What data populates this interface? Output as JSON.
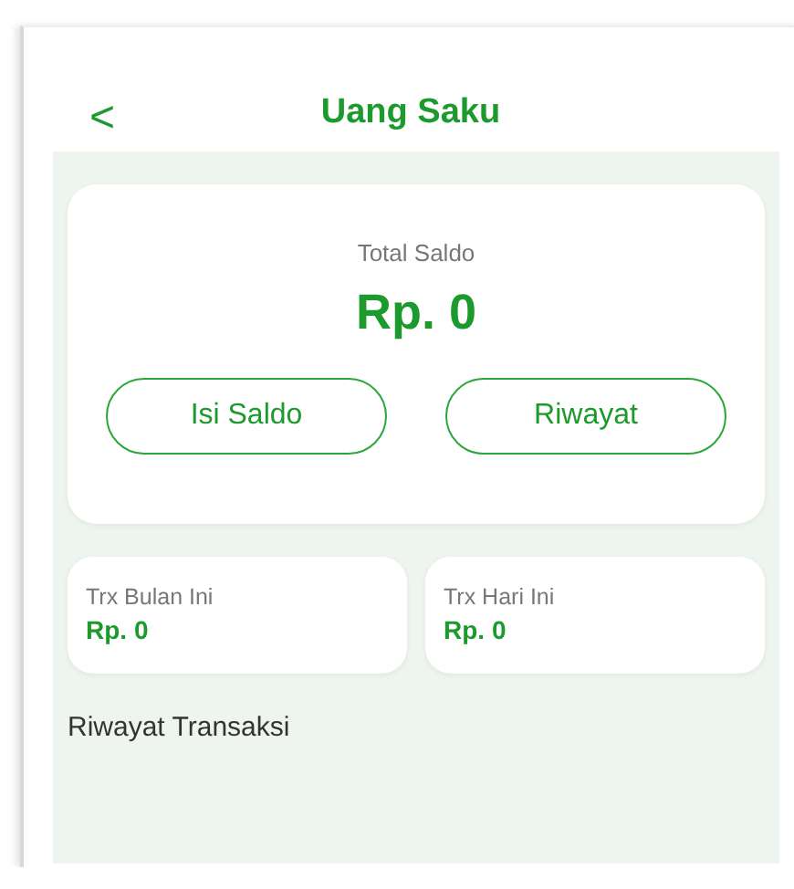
{
  "header": {
    "back": "<",
    "title": "Uang Saku"
  },
  "balance": {
    "label": "Total Saldo",
    "amount": "Rp. 0",
    "buttons": [
      "Isi Saldo",
      "Riwayat"
    ]
  },
  "stats": [
    {
      "label": "Trx Bulan Ini",
      "value": "Rp. 0"
    },
    {
      "label": "Trx Hari Ini",
      "value": "Rp. 0"
    }
  ],
  "section_title": "Riwayat Transaksi"
}
